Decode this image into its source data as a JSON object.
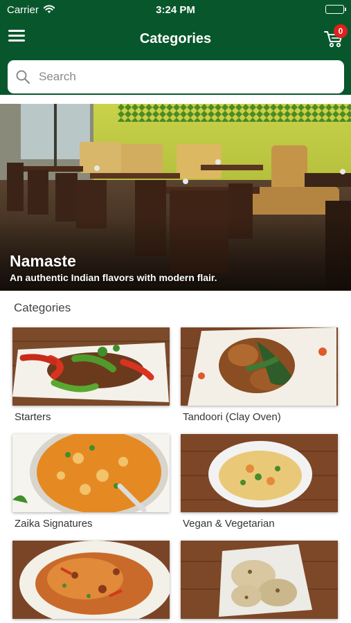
{
  "status_bar": {
    "carrier": "Carrier",
    "time": "3:24 PM"
  },
  "header": {
    "title": "Categories",
    "cart_count": "0"
  },
  "search": {
    "placeholder": "Search"
  },
  "hero": {
    "title": "Namaste",
    "subtitle": "An authentic Indian flavors with modern flair."
  },
  "categories": {
    "heading": "Categories",
    "items": [
      {
        "label": "Starters"
      },
      {
        "label": "Tandoori (Clay Oven)"
      },
      {
        "label": "Zaika Signatures"
      },
      {
        "label": "Vegan & Vegetarian"
      },
      {
        "label": ""
      },
      {
        "label": ""
      }
    ]
  },
  "colors": {
    "header_green": "#08572c",
    "badge_red": "#e0201c",
    "wall_yellow": "#bcc93a"
  },
  "icons": [
    "wifi-icon",
    "battery-icon",
    "menu-icon",
    "cart-icon",
    "search-icon"
  ]
}
